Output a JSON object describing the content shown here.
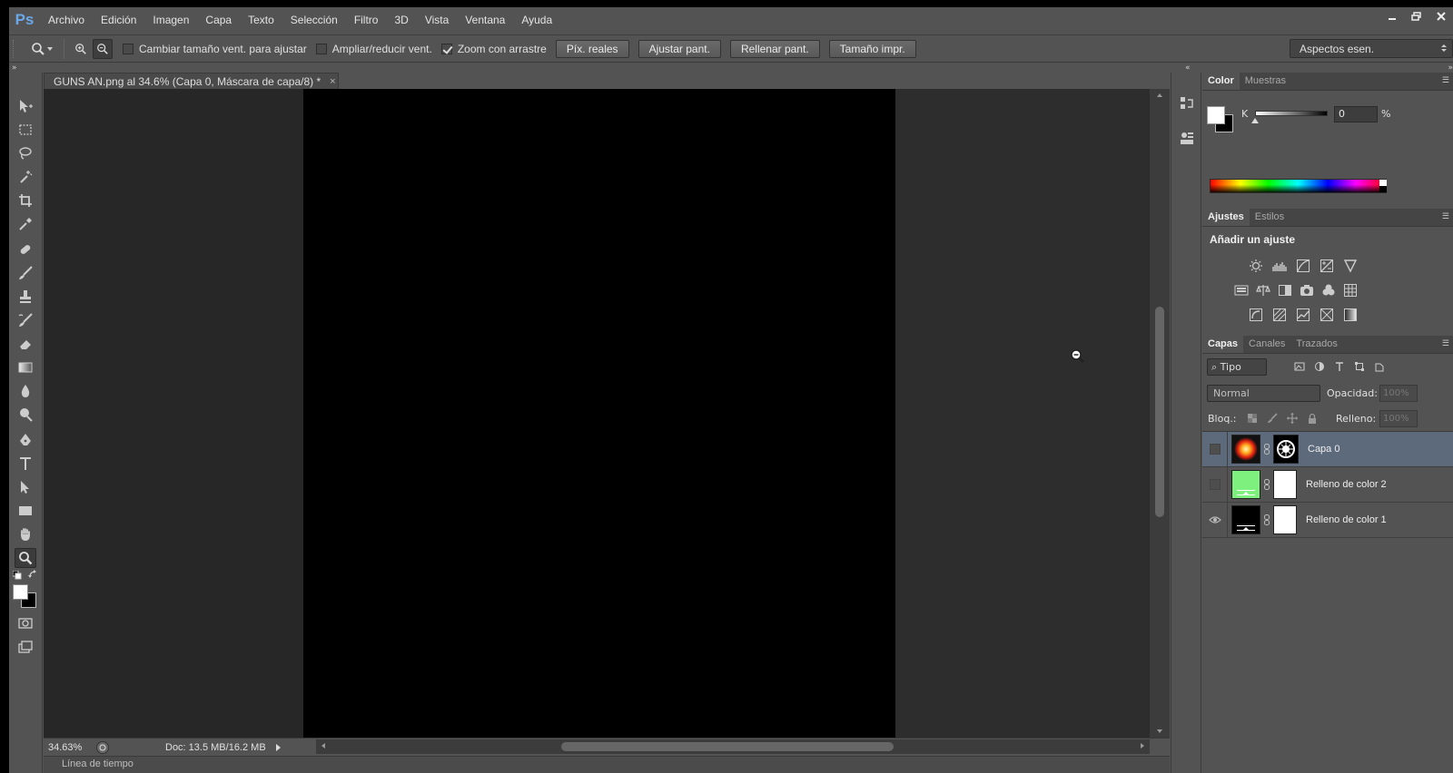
{
  "app": {
    "logo": "Ps"
  },
  "menu": [
    "Archivo",
    "Edición",
    "Imagen",
    "Capa",
    "Texto",
    "Selección",
    "Filtro",
    "3D",
    "Vista",
    "Ventana",
    "Ayuda"
  ],
  "options": {
    "resize_windows": "Cambiar tamaño vent. para ajustar",
    "zoom_all": "Ampliar/reducir vent.",
    "scrubby_zoom": "Zoom con arrastre",
    "buttons": [
      "Píx. reales",
      "Ajustar pant.",
      "Rellenar pant.",
      "Tamaño impr."
    ],
    "workspace": "Aspectos esen."
  },
  "document": {
    "tab_title": "GUNS AN.png al 34.6% (Capa 0, Máscara de capa/8) *",
    "close": "×",
    "zoom": "34.63%",
    "doc_size": "Doc: 13.5 MB/16.2 MB",
    "timeline": "Línea de tiempo"
  },
  "color_panel": {
    "tabs": [
      "Color",
      "Muestras"
    ],
    "channel_label": "K",
    "value": "0",
    "unit": "%",
    "k_value_fraction": 0
  },
  "adjustments_panel": {
    "tabs": [
      "Ajustes",
      "Estilos"
    ],
    "title": "Añadir un ajuste"
  },
  "layers_panel": {
    "tabs": [
      "Capas",
      "Canales",
      "Trazados"
    ],
    "kind": "Tipo",
    "blend_mode": "Normal",
    "opacity_label": "Opacidad:",
    "opacity_value": "100%",
    "lock_label": "Bloq.:",
    "fill_label": "Relleno:",
    "fill_value": "100%",
    "layers": [
      {
        "name": "Capa 0",
        "visible": false,
        "selected": true
      },
      {
        "name": "Relleno de color 2",
        "visible": false,
        "selected": false,
        "color": "#7ef07e"
      },
      {
        "name": "Relleno de color 1",
        "visible": true,
        "selected": false,
        "color": "#000000"
      }
    ]
  },
  "colors": {
    "ui_bg": "#535353",
    "canvas_bg": "#272727",
    "selected_layer": "#5d6a7c",
    "ps_logo": "#6ba8e8"
  }
}
